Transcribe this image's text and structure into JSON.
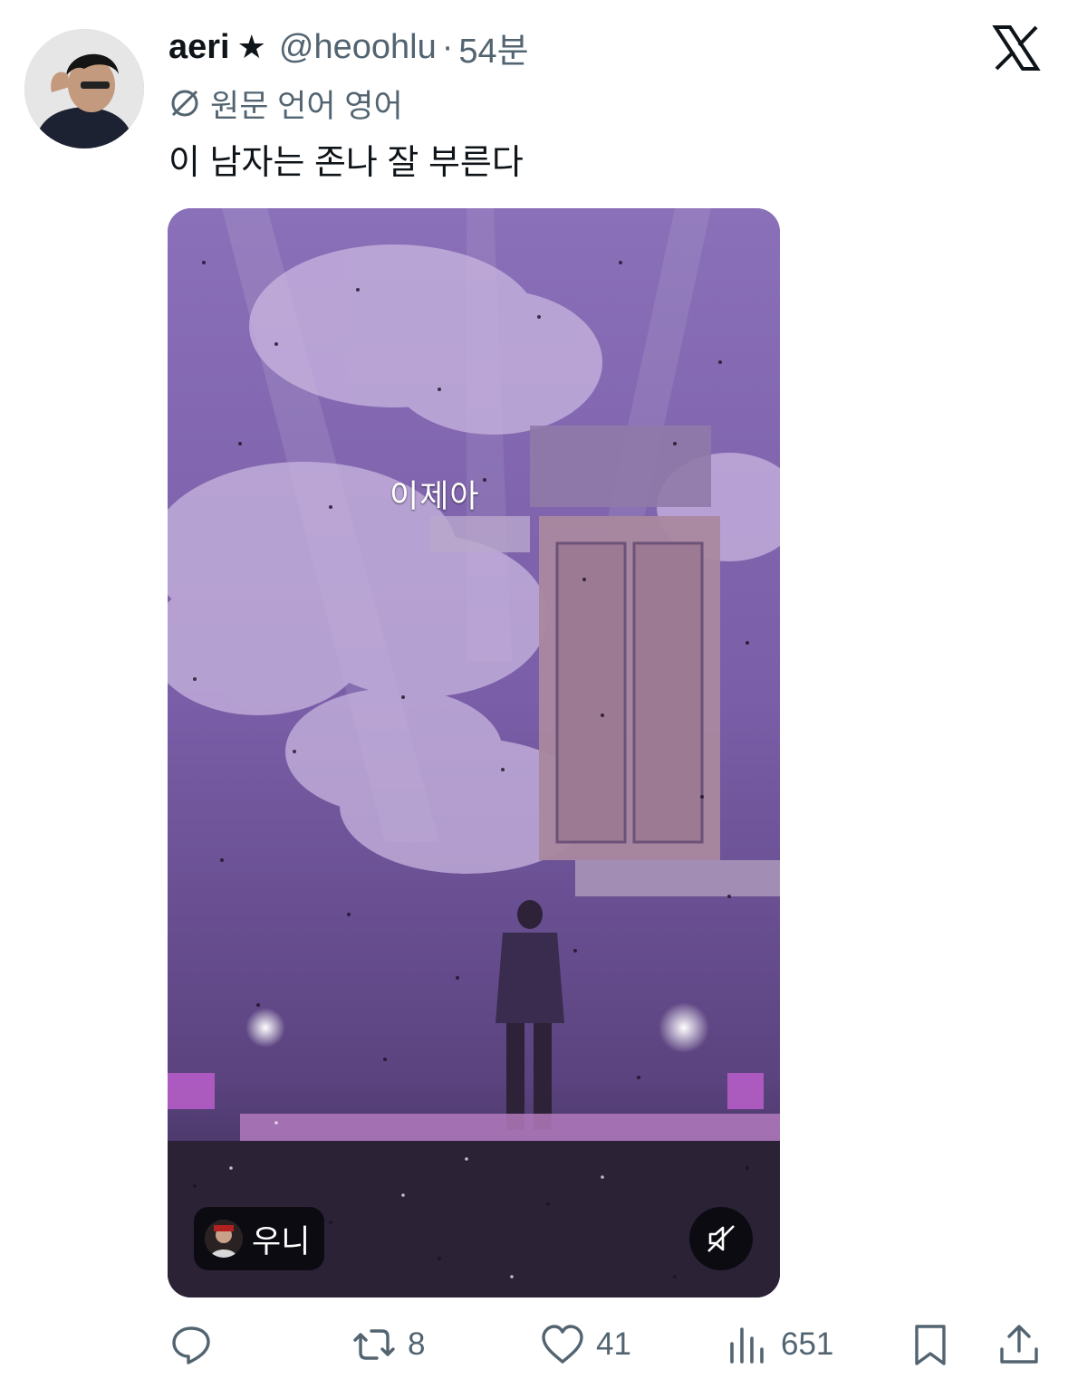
{
  "author": {
    "name": "aeri",
    "badge": "★",
    "handle": "@heoohlu",
    "separator": "·",
    "time": "54분"
  },
  "brand": {
    "logo": "x-logo-icon"
  },
  "translation": {
    "icon": "translate-off-icon",
    "label": "원문 언어 영어"
  },
  "tweet": {
    "text": "이 남자는 존나 잘 부른다"
  },
  "media": {
    "subtitle": "이제아",
    "source_label": "우니",
    "mute_icon": "speaker-muted-icon",
    "accent_color": "#6a4f96"
  },
  "actions": {
    "reply": {
      "icon": "reply-icon",
      "count": ""
    },
    "retweet": {
      "icon": "retweet-icon",
      "count": "8"
    },
    "like": {
      "icon": "heart-icon",
      "count": "41"
    },
    "views": {
      "icon": "views-chart-icon",
      "count": "651"
    },
    "bookmark": {
      "icon": "bookmark-icon"
    },
    "share": {
      "icon": "share-icon"
    }
  },
  "colors": {
    "text_primary": "#0f1419",
    "text_secondary": "#536471"
  }
}
